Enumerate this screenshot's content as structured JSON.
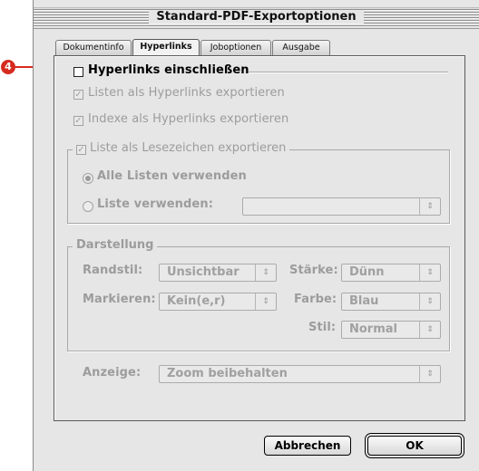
{
  "callout": {
    "number": "4"
  },
  "window": {
    "title": "Standard-PDF-Exportoptionen"
  },
  "tabs": [
    {
      "label": "Dokumentinfo",
      "active": false
    },
    {
      "label": "Hyperlinks",
      "active": true
    },
    {
      "label": "Joboptionen",
      "active": false
    },
    {
      "label": "Ausgabe",
      "active": false
    }
  ],
  "hyperlinks": {
    "include_label": "Hyperlinks einschließen",
    "include_checked": false,
    "lists_label": "Listen als Hyperlinks exportieren",
    "lists_checked": true,
    "indexes_label": "Indexe als Hyperlinks exportieren",
    "indexes_checked": true
  },
  "bookmarks": {
    "title": "Liste als Lesezeichen exportieren",
    "checked": true,
    "all_lists_label": "Alle Listen verwenden",
    "use_list_label": "Liste verwenden:",
    "use_list_value": ""
  },
  "display": {
    "title": "Darstellung",
    "border_style_label": "Randstil:",
    "border_style_value": "Unsichtbar",
    "highlight_label": "Markieren:",
    "highlight_value": "Kein(e,r)",
    "width_label": "Stärke:",
    "width_value": "Dünn",
    "color_label": "Farbe:",
    "color_value": "Blau",
    "style_label": "Stil:",
    "style_value": "Normal"
  },
  "view": {
    "label": "Anzeige:",
    "value": "Zoom beibehalten"
  },
  "buttons": {
    "cancel": "Abbrechen",
    "ok": "OK"
  },
  "arrow_glyph": "⇕",
  "check_glyph": "✓",
  "colors": {
    "callout": "#d62b1f",
    "dimmed_text": "#9c9c9c"
  }
}
